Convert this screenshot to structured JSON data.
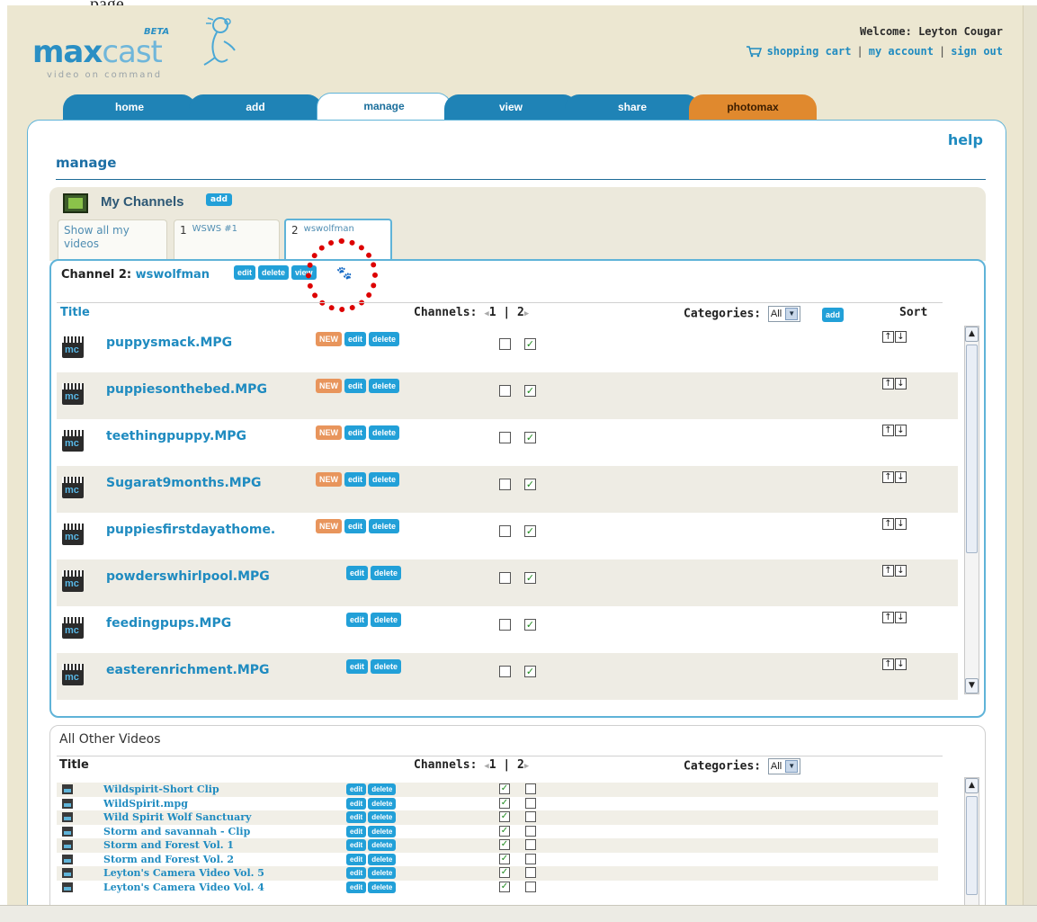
{
  "top_fragment": "page.",
  "header": {
    "logo_max": "max",
    "logo_cast": "cast",
    "logo_beta": "BETA",
    "tagline": "video on command",
    "welcome": "Welcome: Leyton Cougar",
    "links": {
      "cart": "shopping cart",
      "account": "my account",
      "signout": "sign out",
      "separator": "|"
    }
  },
  "tabs": [
    {
      "label": "home"
    },
    {
      "label": "add"
    },
    {
      "label": "manage",
      "active": true
    },
    {
      "label": "view"
    },
    {
      "label": "share"
    },
    {
      "label": "photomax"
    }
  ],
  "help": "help",
  "page_title": "manage",
  "my_channels": {
    "title": "My Channels",
    "add": "add",
    "channel_tabs": {
      "show_all": "Show all my videos",
      "tab1_num": "1",
      "tab1_name": "WSWS #1",
      "tab2_num": "2",
      "tab2_name": "wswolfman"
    }
  },
  "channel": {
    "label": "Channel 2:",
    "name": "wswolfman",
    "edit": "edit",
    "delete": "delete",
    "view": "view"
  },
  "table": {
    "title_header": "Title",
    "channels_header": "Channels:",
    "ch1": "1",
    "ch_sep": "|",
    "ch2": "2",
    "categories_header": "Categories:",
    "categories_value": "All",
    "cat_add": "add",
    "sort_header": "Sort"
  },
  "buttons": {
    "new": "NEW",
    "edit": "edit",
    "delete": "delete"
  },
  "videos": [
    {
      "name": "puppysmack.MPG",
      "new": true,
      "c1": false,
      "c2": true
    },
    {
      "name": "puppiesonthebed.MPG",
      "new": true,
      "c1": false,
      "c2": true
    },
    {
      "name": "teethingpuppy.MPG",
      "new": true,
      "c1": false,
      "c2": true
    },
    {
      "name": "Sugarat9months.MPG",
      "new": true,
      "c1": false,
      "c2": true
    },
    {
      "name": "puppiesfirstdayathome.",
      "new": true,
      "c1": false,
      "c2": true
    },
    {
      "name": "powderswhirlpool.MPG",
      "new": false,
      "c1": false,
      "c2": true
    },
    {
      "name": "feedingpups.MPG",
      "new": false,
      "c1": false,
      "c2": true
    },
    {
      "name": "easterenrichment.MPG",
      "new": false,
      "c1": false,
      "c2": true
    }
  ],
  "other": {
    "title": "All Other Videos",
    "title_header": "Title",
    "channels_header": "Channels:",
    "ch1": "1",
    "ch_sep": "|",
    "ch2": "2",
    "categories_header": "Categories:",
    "categories_value": "All"
  },
  "other_videos": [
    {
      "name": "Wildspirit-Short Clip",
      "c1": true,
      "c2": false
    },
    {
      "name": "WildSpirit.mpg",
      "c1": true,
      "c2": false
    },
    {
      "name": "Wild Spirit Wolf Sanctuary",
      "c1": true,
      "c2": false
    },
    {
      "name": "Storm and savannah - Clip",
      "c1": true,
      "c2": false
    },
    {
      "name": "Storm and Forest Vol. 1",
      "c1": true,
      "c2": false
    },
    {
      "name": "Storm and Forest Vol. 2",
      "c1": true,
      "c2": false
    },
    {
      "name": "Leyton's Camera Video Vol. 5",
      "c1": true,
      "c2": false
    },
    {
      "name": "Leyton's Camera Video Vol. 4",
      "c1": true,
      "c2": false
    }
  ],
  "colors": {
    "accent": "#1f8bc0",
    "tab": "#1f83b6",
    "photomax": "#e0892e",
    "annotation": "#dd0000"
  }
}
